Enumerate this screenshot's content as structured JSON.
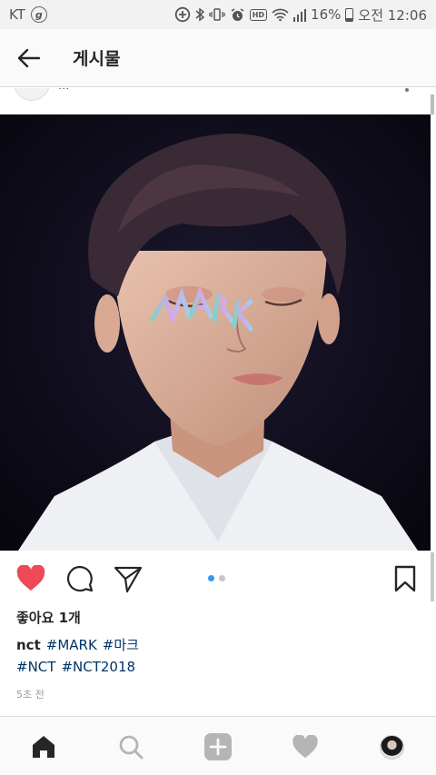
{
  "status_bar": {
    "carrier": "KT",
    "carrier_badge": "g",
    "hd_label": "HD",
    "battery_text": "16%",
    "battery_level": 0.16,
    "time": "오전 12:06",
    "icons": [
      "add-circle-icon",
      "bluetooth-icon",
      "vibrate-icon",
      "alarm-icon",
      "hd-icon",
      "wifi-icon",
      "signal-icon",
      "battery-icon"
    ]
  },
  "header": {
    "back_icon": "arrow-left-icon",
    "title": "게시물"
  },
  "post": {
    "likes": "좋아요 1개",
    "caption": {
      "owner": "nct",
      "line1_tags": [
        "#MARK",
        "#마크"
      ],
      "line2_tags": [
        "#NCT",
        "#NCT2018"
      ]
    },
    "time_ago": "5초 전",
    "carousel": {
      "count": 2,
      "active_index": 0
    }
  },
  "colors": {
    "like_red": "#ed4956",
    "hashtag_blue": "#003569",
    "carousel_active": "#3897f0"
  },
  "bottom_nav": {
    "items": [
      "home-icon",
      "search-icon",
      "add-post-icon",
      "activity-heart-icon",
      "profile-avatar"
    ]
  }
}
